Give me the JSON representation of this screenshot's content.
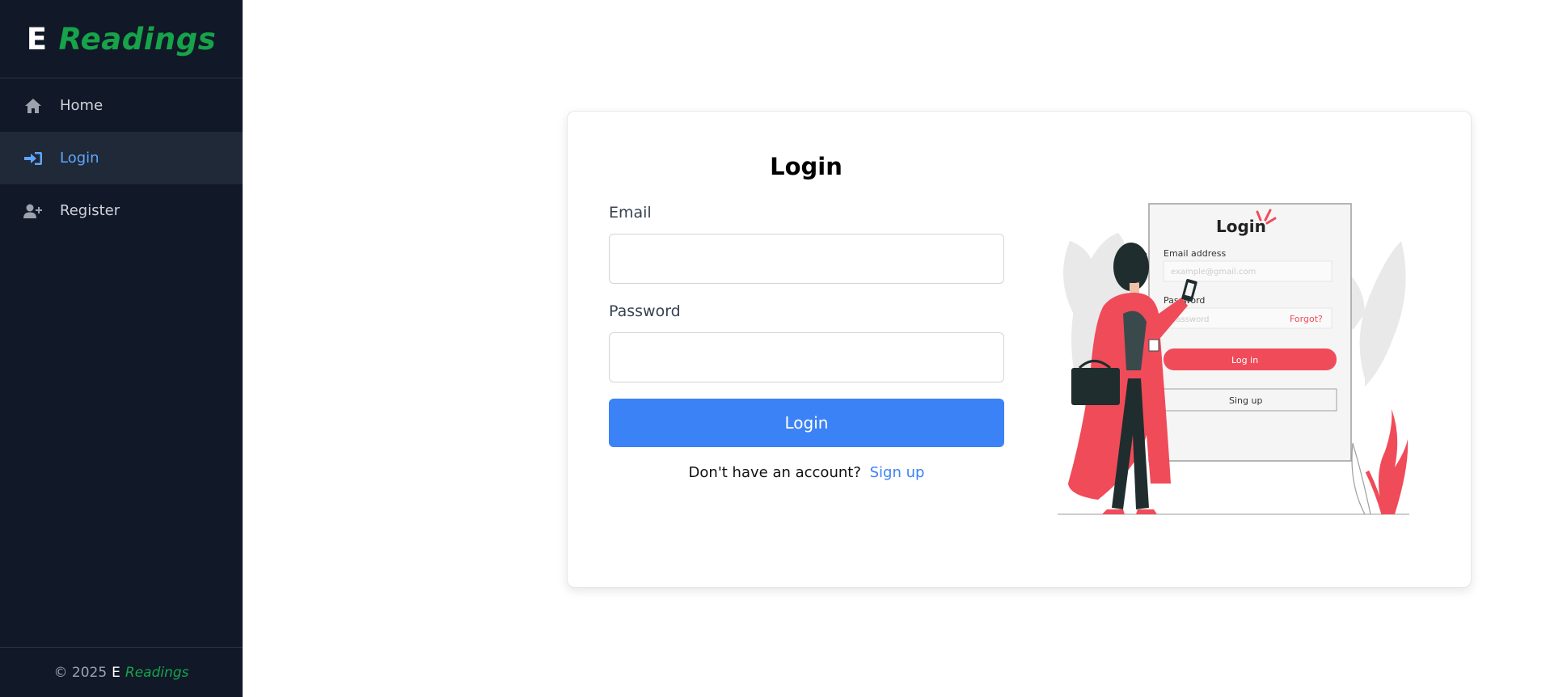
{
  "brand": {
    "letter": "E",
    "word": "Readings"
  },
  "nav": {
    "items": [
      {
        "label": "Home",
        "icon": "home-icon"
      },
      {
        "label": "Login",
        "icon": "sign-in-icon",
        "active": true
      },
      {
        "label": "Register",
        "icon": "user-plus-icon"
      }
    ]
  },
  "footer": {
    "copyright": "© 2025",
    "brand_letter": "E",
    "brand_word": "Readings"
  },
  "form": {
    "title": "Login",
    "email_label": "Email",
    "email_value": "",
    "password_label": "Password",
    "password_value": "",
    "submit_label": "Login",
    "signup_prompt": "Don't have an account?",
    "signup_link": "Sign up"
  },
  "illustration": {
    "title": "Login",
    "email_label": "Email address",
    "email_placeholder": "example@gmail.com",
    "password_label": "Password",
    "password_placeholder": "password",
    "forgot": "Forgot?",
    "login_button": "Log in",
    "signup_button": "Sing up"
  },
  "colors": {
    "sidebar": "#111827",
    "accent": "#3b82f6",
    "brand_green": "#16a34a",
    "active_link": "#60a5fa",
    "illustration_red": "#f04b59"
  }
}
